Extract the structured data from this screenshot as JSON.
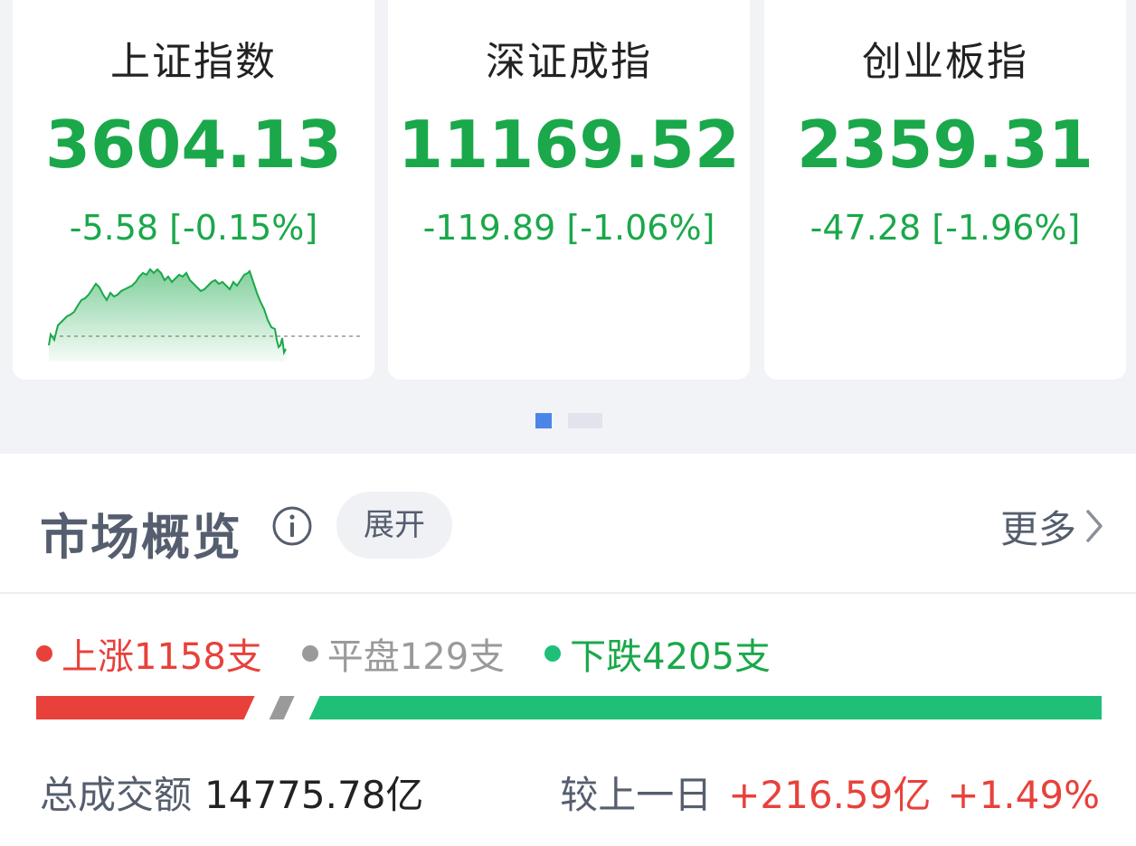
{
  "index_cards": [
    {
      "name": "上证指数",
      "value": "3604.13",
      "change": "-5.58 [-0.15%]"
    },
    {
      "name": "深证成指",
      "value": "11169.52",
      "change": "-119.89 [-1.06%]"
    },
    {
      "name": "创业板指",
      "value": "2359.31",
      "change": "-47.28 [-1.96%]"
    }
  ],
  "pager": {
    "page_count": 2,
    "active_page": 1
  },
  "market": {
    "title": "市场概览",
    "info_icon": "info-circle-icon",
    "expand_label": "展开",
    "more_label": "更多",
    "more_icon": "chevron-right-icon",
    "rise_label": "上涨1158支",
    "flat_label": "平盘129支",
    "fall_label": "下跌4205支",
    "rise_count": 1158,
    "flat_count": 129,
    "fall_count": 4205,
    "turnover_label": "总成交额",
    "turnover_value": "14775.78亿",
    "compare_label": "较上一日",
    "compare_amount": "+216.59亿",
    "compare_pct": "+1.49%"
  },
  "colors": {
    "down_green": "#1aa84a",
    "up_red": "#e8413b",
    "flat_gray": "#9a9a9a",
    "fall_bar": "#1fbf78",
    "pager_active": "#4a86e8"
  }
}
